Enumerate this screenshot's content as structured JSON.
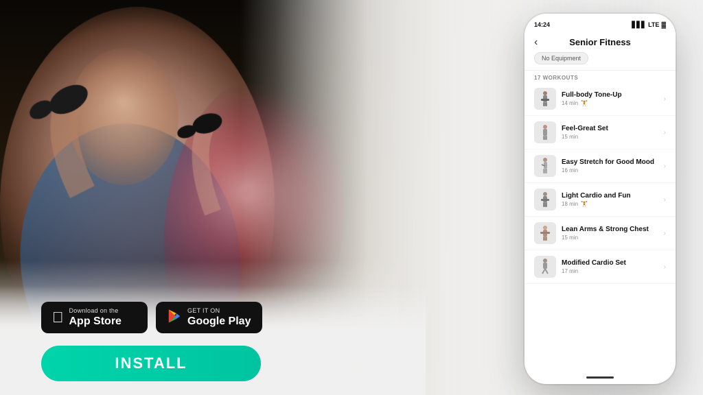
{
  "background": {
    "alt": "Senior couple lifting dumbbells at gym"
  },
  "app_store_button": {
    "small_text": "Download on the",
    "large_text": "App Store"
  },
  "google_play_button": {
    "small_text": "GET IT ON",
    "large_text": "Google Play"
  },
  "install_button": {
    "label": "INSTALL"
  },
  "phone": {
    "status_bar": {
      "time": "14:24",
      "signal": "LTE",
      "battery": "🔋"
    },
    "header": {
      "back_label": "‹",
      "title": "Senior Fitness"
    },
    "filter_tag": "No Equipment",
    "workouts_count_label": "17 WORKOUTS",
    "workouts": [
      {
        "name": "Full-body Tone-Up",
        "duration": "14 min",
        "has_equipment": true
      },
      {
        "name": "Feel-Great Set",
        "duration": "15 min",
        "has_equipment": false
      },
      {
        "name": "Easy Stretch for Good Mood",
        "duration": "16 min",
        "has_equipment": false
      },
      {
        "name": "Light Cardio and Fun",
        "duration": "18 min",
        "has_equipment": true
      },
      {
        "name": "Lean Arms & Strong Chest",
        "duration": "15 min",
        "has_equipment": false
      },
      {
        "name": "Modified Cardio Set",
        "duration": "17 min",
        "has_equipment": false
      }
    ]
  },
  "colors": {
    "install_bg": "#00c8a0",
    "store_btn_bg": "#111111",
    "phone_bg": "#ffffff",
    "tag_bg": "#f0f0f0"
  }
}
